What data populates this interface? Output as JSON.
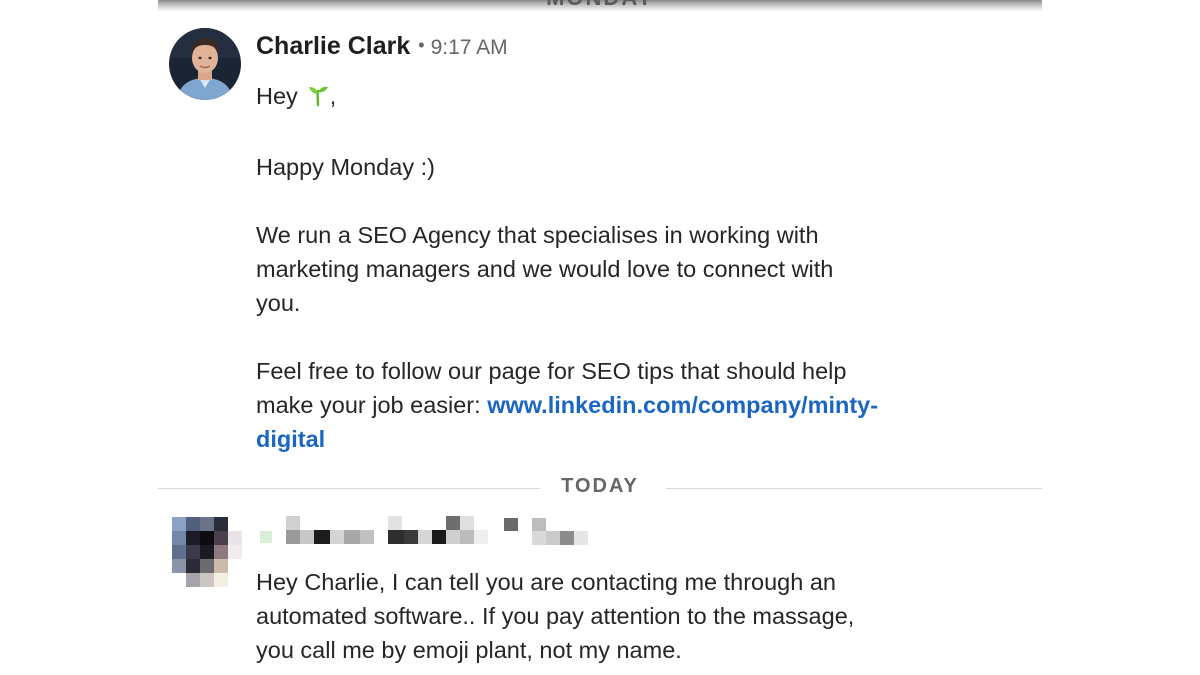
{
  "header": {
    "day_label": "MONDAY"
  },
  "message_1": {
    "sender": "Charlie Clark",
    "time": "9:17 AM",
    "greeting_prefix": "Hey",
    "greeting_suffix": ",",
    "greeting_emoji": "seedling-emoji",
    "para_2": "Happy Monday :)",
    "para_3_line_1": "We run a SEO Agency that specialises in working with",
    "para_3_line_2": "marketing managers and we would love to connect with",
    "para_3_line_3": "you.",
    "para_4_line_1": "Feel free to follow our page for SEO tips that should help",
    "para_4_line_2_prefix": "make your job easier: ",
    "link_part_1": "www.linkedin.com/company/minty-",
    "link_part_2": "digital"
  },
  "divider": {
    "label": "TODAY"
  },
  "message_2": {
    "sender_pixelated": true,
    "line_1": "Hey Charlie, I can tell you are contacting me through an",
    "line_2": "automated software.. If you pay attention to the massage,",
    "line_3": "you call me by emoji plant, not my name."
  },
  "colors": {
    "link": "#1a66c2",
    "text": "#262626",
    "muted": "#666666"
  }
}
